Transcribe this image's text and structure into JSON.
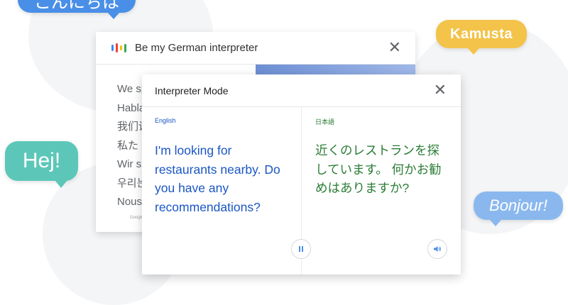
{
  "bubbles": {
    "top_left": "こんにちは",
    "kamusta": "Kamusta",
    "hej": "Hej!",
    "bonjour": "Bonjour!"
  },
  "back_card": {
    "title": "Be my German interpreter",
    "lines": [
      "We sp",
      "Habla",
      "我们说",
      "私た",
      "Wir s",
      "우리는",
      "Nous"
    ],
    "footer": "Google"
  },
  "front_card": {
    "title": "Interpreter Mode",
    "left": {
      "language": "English",
      "text": "I'm looking for restaurants nearby. Do you have any recommendations?",
      "icon": "pause-icon"
    },
    "right": {
      "language": "日本語",
      "text": "近くのレストランを探しています。 何かお勧めはありますか?",
      "icon": "speaker-icon"
    }
  },
  "icons": {
    "close": "close-icon",
    "mic_colors": [
      "#4285f4",
      "#ea4335",
      "#fbbc05",
      "#34a853"
    ]
  },
  "colors": {
    "source_text": "#1a56c4",
    "target_text": "#2b7d36",
    "bubble_blue": "#4a8fe7",
    "bubble_yellow": "#f3c34a",
    "bubble_teal": "#5cc7b8",
    "bubble_lightblue": "#8ab8ee"
  }
}
